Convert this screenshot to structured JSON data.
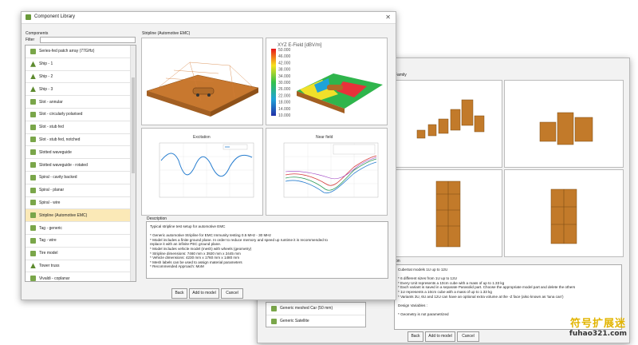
{
  "left_window": {
    "title": "Component Library",
    "components_label": "Components",
    "filter_label": "Filter",
    "items": [
      {
        "label": "Series-fed patch array (77GHz)",
        "icon": "sq"
      },
      {
        "label": "Ship - 1",
        "icon": "tri"
      },
      {
        "label": "Ship - 2",
        "icon": "tri"
      },
      {
        "label": "Ship - 3",
        "icon": "tri"
      },
      {
        "label": "Slot - annular",
        "icon": "sq"
      },
      {
        "label": "Slot - circularly polarised",
        "icon": "sq"
      },
      {
        "label": "Slot - stub fed",
        "icon": "sq"
      },
      {
        "label": "Slot - stub fed, notched",
        "icon": "sq"
      },
      {
        "label": "Slotted waveguide",
        "icon": "sq"
      },
      {
        "label": "Slotted waveguide - rotated",
        "icon": "sq"
      },
      {
        "label": "Spiral - cavity backed",
        "icon": "sq"
      },
      {
        "label": "Spiral - planar",
        "icon": "sq"
      },
      {
        "label": "Spiral - wire",
        "icon": "sq"
      },
      {
        "label": "Stripline (Automotive EMC)",
        "icon": "sq",
        "selected": true
      },
      {
        "label": "Tag - generic",
        "icon": "sq"
      },
      {
        "label": "Tag - wire",
        "icon": "sq"
      },
      {
        "label": "Tire model",
        "icon": "sq"
      },
      {
        "label": "Tower truss",
        "icon": "tri"
      },
      {
        "label": "Vivaldi - coplanar",
        "icon": "sq"
      },
      {
        "label": "Yagi Uda",
        "icon": "sq"
      }
    ],
    "preview_title": "Stripline (Automotive EMC)",
    "efield_title": "XYZ E-Field [dBV/m]",
    "efield_scale": [
      "50.000",
      "46.000",
      "42.000",
      "38.000",
      "34.000",
      "30.000",
      "26.000",
      "22.000",
      "18.000",
      "14.000",
      "10.000"
    ],
    "chart1_title": "Excitation",
    "chart2_title": "Near field",
    "description_label": "Description",
    "description_lines": [
      "Typical stripline test setup for automotive EMC",
      "",
      "* Generic automotive Stripline for EMC Immunity testing 0.5 MHz - 30 MHz",
      "* Model includes a finite ground plane. In order to reduce memory and speed up runtime it is recommended to",
      "  replace it with an infinite PEC ground plane.",
      "* Model includes vehicle model (mesh) with wheels (geometry)",
      "* Stripline dimensions: 7460 mm x 3920 mm x 2445 mm",
      "* Vehicle dimensions: 4230 mm x 1760 mm x 1480 mm",
      "* Mesh labels can be used to assign material parameters",
      "* Recommended Approach: MoM"
    ],
    "buttons": {
      "back": "Back",
      "add": "Add to model",
      "cancel": "Cancel"
    }
  },
  "right_window": {
    "family_label": "Family",
    "list_items": [
      "Generic meshed Car (50 mm)",
      "Generic Satellite"
    ],
    "description_label": "ion",
    "description_lines": [
      "CubeSat models 1U up to 12U",
      "",
      "* 6 different sizes from 1U up to 12U",
      "* Every Unit represents a 10cm cube with a mass of up to 1.33 kg",
      "* Each variant is saved in a separate Parasolid part. Choose the appropriate model part and delete the others",
      "* 1U represents a 10cm cube with a mass of up to 1.33 kg",
      "* Variants 3U, 6U and 12U can have an optional extra volume at the -Z face (also known as 'tuna can')",
      "",
      "Design Variables :",
      "",
      "* Geometry is not parametrized"
    ],
    "buttons": {
      "back": "Back",
      "add": "Add to model",
      "cancel": "Cancel"
    }
  },
  "watermark": {
    "cn": "符号扩展迷",
    "url": "fuhao321.com"
  },
  "colors": {
    "selected": "#fbe9b7",
    "ground": "#c8782f",
    "truss": "#c8802e"
  }
}
